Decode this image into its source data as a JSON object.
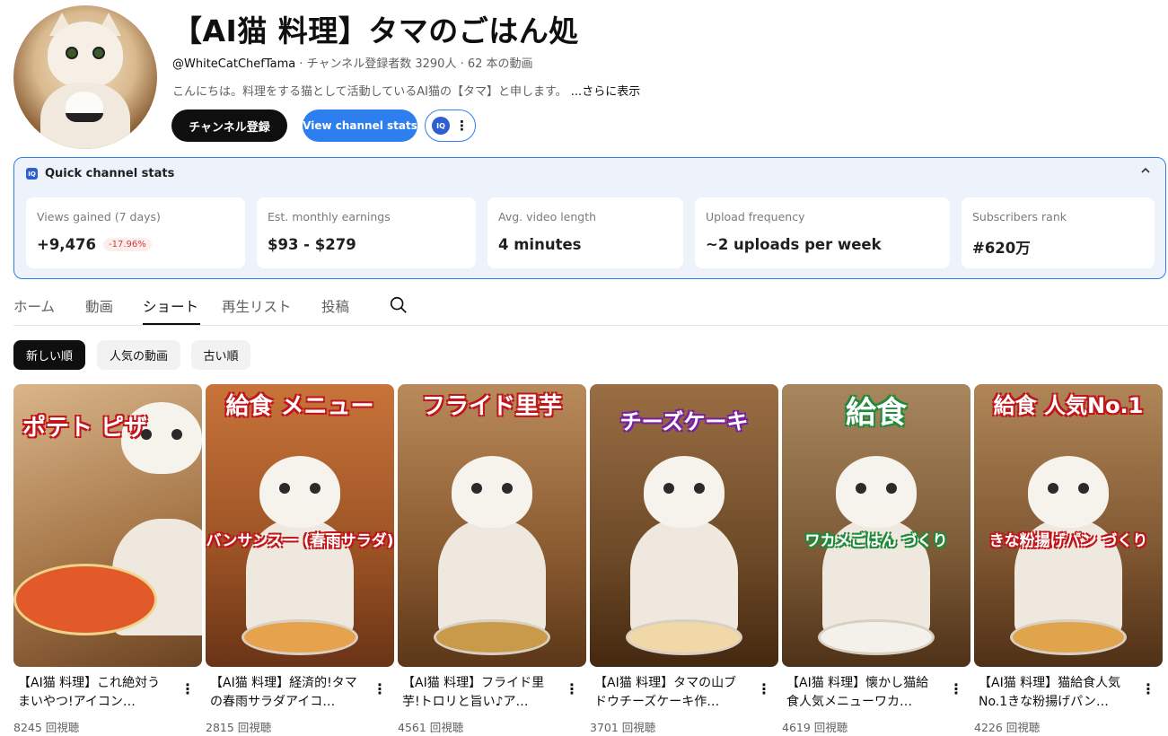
{
  "channel": {
    "title": "【AI猫 料理】タマのごはん処",
    "handle": "@WhiteCatChefTama",
    "meta_rest": " · チャンネル登録者数 3290人 · 62 本の動画",
    "description": "こんにちは。料理をする猫として活動しているAI猫の【タマ】と申します。",
    "more_label": "...さらに表示"
  },
  "buttons": {
    "subscribe": "チャンネル登録",
    "view_stats": "View channel stats",
    "iq_badge": "IQ",
    "more_icon": "⋮"
  },
  "stats": {
    "title": "Quick channel stats",
    "collapse_icon": "chevron-up",
    "cards": [
      {
        "label": "Views gained (7 days)",
        "value": "+9,476",
        "delta": "-17.96%"
      },
      {
        "label": "Est. monthly earnings",
        "value": "$93 - $279"
      },
      {
        "label": "Avg. video length",
        "value": "4 minutes"
      },
      {
        "label": "Upload frequency",
        "value": "~2 uploads per week"
      },
      {
        "label": "Subscribers rank",
        "value": "#620万"
      }
    ]
  },
  "tabs": [
    "ホーム",
    "動画",
    "ショート",
    "再生リスト",
    "投稿"
  ],
  "active_tab": "ショート",
  "chips": [
    "新しい順",
    "人気の動画",
    "古い順"
  ],
  "active_chip": "新しい順",
  "shorts": [
    {
      "title": "【AI猫 料理】これ絶対うまいやつ!アイコン…",
      "views": "8245 回視聴",
      "caption_top": "ポテト ピザ",
      "caption_mid": "",
      "bg": "#c9a27a"
    },
    {
      "title": "【AI猫 料理】経済的!タマの春雨サラダアイコ…",
      "views": "2815 回視聴",
      "caption_top": "給食 メニュー",
      "caption_mid": "バンサンスー (春雨サラダ)",
      "bg": "#b8642a"
    },
    {
      "title": "【AI猫 料理】フライド里芋!トロリと旨い♪ア…",
      "views": "4561 回視聴",
      "caption_top": "フライド里芋",
      "caption_mid": "",
      "bg": "#9c6a3a"
    },
    {
      "title": "【AI猫 料理】タマの山ブドウチーズケーキ作…",
      "views": "3701 回視聴",
      "caption_top": "チーズケーキ",
      "caption_mid": "",
      "bg": "#7d5632"
    },
    {
      "title": "【AI猫 料理】懐かし猫給食人気メニューワカ…",
      "views": "4619 回視聴",
      "caption_top": "給食",
      "caption_mid": "ワカメごはん づくり",
      "bg": "#8a6a44"
    },
    {
      "title": "【AI猫 料理】猫給食人気No.1きな粉揚げパン…",
      "views": "4226 回視聴",
      "caption_top": "給食 人気No.1",
      "caption_mid": "きな粉揚げパン づくり",
      "bg": "#93643a"
    }
  ]
}
